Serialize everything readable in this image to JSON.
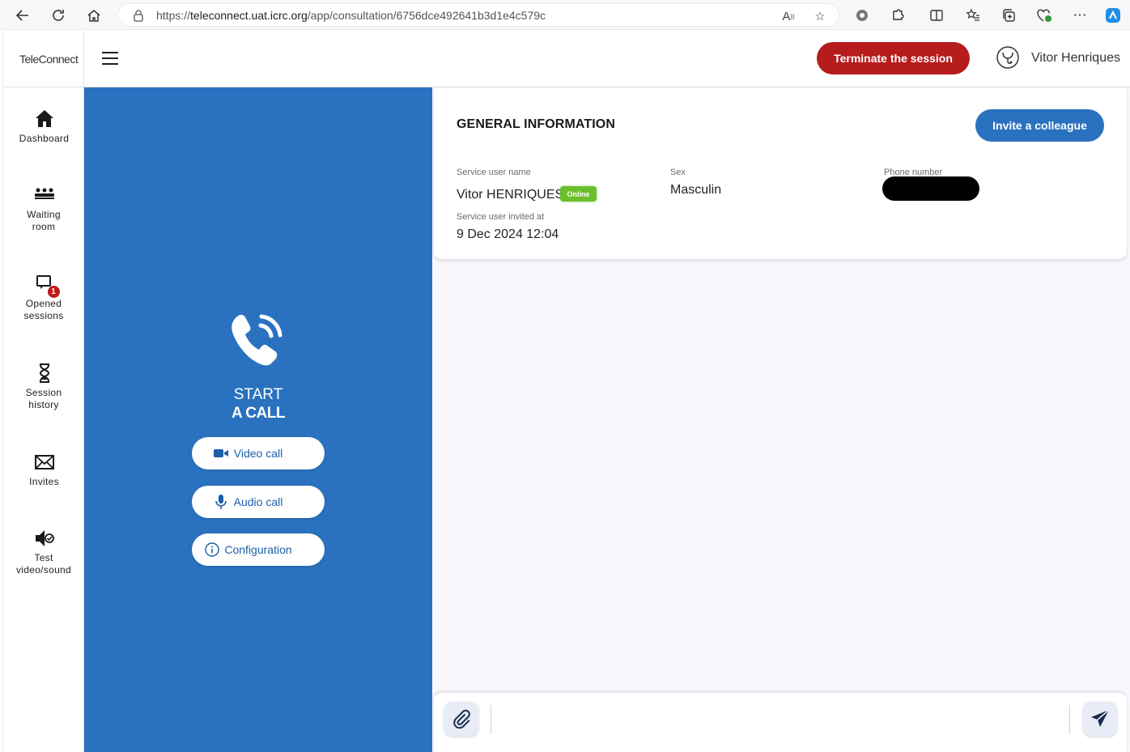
{
  "browser": {
    "url_prefix": "https://",
    "url_host": "teleconnect.uat.icrc.org",
    "url_path": "/app/consultation/6756dce492641b3d1e4c579c"
  },
  "app": {
    "logo": "TeleConnect"
  },
  "sidebar": {
    "items": [
      {
        "label": "Dashboard",
        "icon": "home-icon"
      },
      {
        "label": "Waiting room",
        "icon": "waiting-room-icon"
      },
      {
        "label": "Opened sessions",
        "icon": "opened-sessions-icon",
        "badge": "1"
      },
      {
        "label": "Session history",
        "icon": "hourglass-icon"
      },
      {
        "label": "Invites",
        "icon": "envelope-icon"
      },
      {
        "label": "Test video/sound",
        "icon": "test-sound-icon"
      }
    ]
  },
  "header": {
    "terminate_label": "Terminate the session",
    "user_name": "Vitor Henriques"
  },
  "call_panel": {
    "start_label": "START",
    "call_label": "A CALL",
    "video_call_label": "Video call",
    "audio_call_label": "Audio call",
    "configuration_label": "Configuration"
  },
  "general_info": {
    "title": "GENERAL INFORMATION",
    "invite_label": "Invite a colleague",
    "service_user_name_label": "Service user name",
    "service_user_name": "Vitor HENRIQUES",
    "status": "Online",
    "sex_label": "Sex",
    "sex": "Masculin",
    "phone_label": "Phone number",
    "invited_at_label": "Service user invited at",
    "invited_at": "9 Dec 2024 12:04"
  },
  "message_bar": {
    "placeholder": ""
  },
  "colors": {
    "primary": "#2a72bf",
    "danger": "#b71c1c",
    "online": "#6abf2b"
  }
}
